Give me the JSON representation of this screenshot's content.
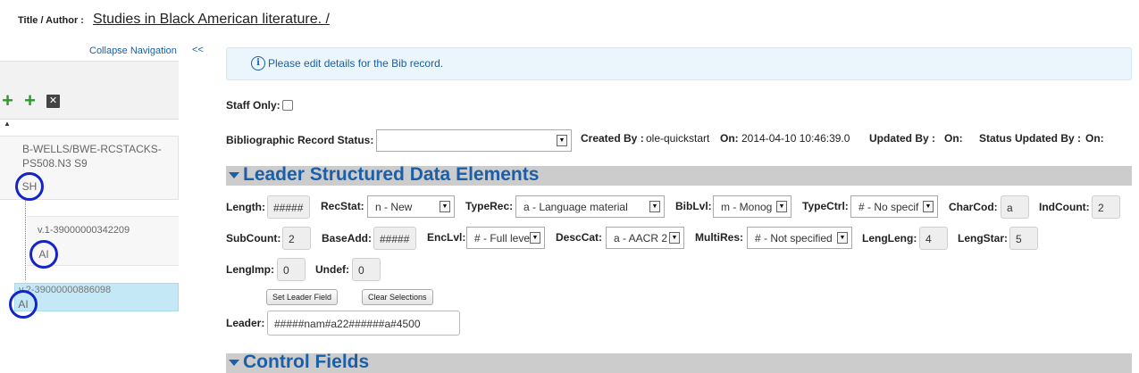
{
  "header": {
    "title_label": "Title / Author :",
    "title_value": "Studies in Black American literature. /"
  },
  "nav": {
    "collapse_label": "Collapse Navigation",
    "collapse_arrows": "<<",
    "toolbar": {
      "add_icon_1": "plus-icon",
      "add_icon_2": "plus-icon",
      "delete_icon": "close-icon",
      "add_glyph": "+",
      "delete_glyph": "✕"
    },
    "tree_marker": "▲",
    "holding": {
      "label": "B-WELLS/BWE-RCSTACKS-PS508.N3 S9",
      "badge": "SH"
    },
    "items": [
      {
        "label": "v.1-39000000342209",
        "badge": "AI",
        "selected": false
      },
      {
        "label": "v.2-39000000886098",
        "badge": "AI",
        "selected": true
      }
    ]
  },
  "info": {
    "icon": "info-icon",
    "icon_glyph": "i",
    "message": "Please edit details for the Bib record."
  },
  "staff_only": {
    "label": "Staff Only:",
    "checked": false
  },
  "status_row": {
    "record_status_label": "Bibliographic Record Status:",
    "record_status_value": "",
    "created_by_label": "Created By :",
    "created_by_value": "ole-quickstart",
    "on_label": "On:",
    "on_value": "2014-04-10 10:46:39.0",
    "updated_by_label": "Updated By :",
    "updated_on_label": "On:",
    "status_updated_by_label": "Status Updated By :",
    "status_updated_on_label": "On:"
  },
  "leader_section": {
    "title": "Leader Structured Data Elements",
    "length_label": "Length:",
    "length_value": "#####",
    "recstat_label": "RecStat:",
    "recstat_value": "n - New",
    "typerec_label": "TypeRec:",
    "typerec_value": "a - Language material",
    "biblvl_label": "BibLvl:",
    "biblvl_value": "m - Monog",
    "typectrl_label": "TypeCtrl:",
    "typectrl_value": "# - No specif",
    "charcod_label": "CharCod:",
    "charcod_value": "a",
    "indcount_label": "IndCount:",
    "indcount_value": "2",
    "subcount_label": "SubCount:",
    "subcount_value": "2",
    "baseadd_label": "BaseAdd:",
    "baseadd_value": "#####",
    "enclvl_label": "EncLvl:",
    "enclvl_value": "# - Full leve",
    "desccat_label": "DescCat:",
    "desccat_value": "a - AACR 2",
    "multires_label": "MultiRes:",
    "multires_value": "# - Not specified",
    "lengleng_label": "LengLeng:",
    "lengleng_value": "4",
    "lengstar_label": "LengStar:",
    "lengstar_value": "5",
    "lengimp_label": "LengImp:",
    "lengimp_value": "0",
    "undef_label": "Undef:",
    "undef_value": "0",
    "set_leader_button": "Set Leader Field",
    "clear_button": "Clear Selections",
    "leader_label": "Leader:",
    "leader_value": "#####nam#a22######a#4500"
  },
  "control_section": {
    "title": "Control Fields"
  },
  "colors": {
    "accent": "#1a5fa8",
    "badge_circle": "#1424c8",
    "selected_bg": "#c4e8f6",
    "plus": "#2e9a2e"
  }
}
